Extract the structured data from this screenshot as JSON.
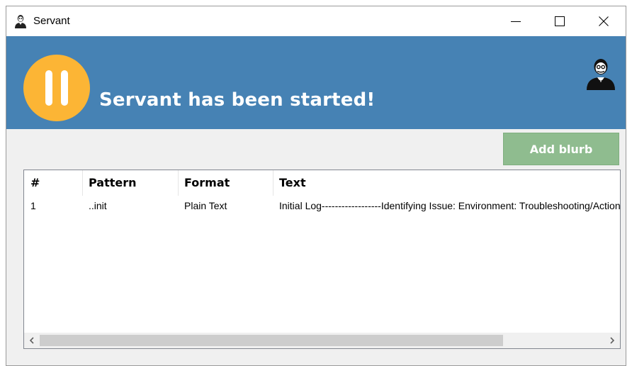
{
  "window": {
    "title": "Servant",
    "icon": "servant-butler-icon",
    "controls": [
      "minimize-icon",
      "maximize-icon",
      "close-icon"
    ]
  },
  "banner": {
    "status_icon": "pause-icon",
    "status_text": "Servant has been started!",
    "logo_icon": "servant-butler-icon",
    "background_color": "#4682b4",
    "status_icon_color": "#fcb535"
  },
  "toolbar": {
    "add_label": "Add blurb",
    "add_color": "#8fbc8f"
  },
  "table": {
    "columns": [
      "#",
      "Pattern",
      "Format",
      "Text"
    ],
    "rows": [
      [
        "1",
        "..init",
        "Plain Text",
        "Initial Log------------------Identifying Issue: Environment: Troubleshooting/Action"
      ]
    ]
  }
}
